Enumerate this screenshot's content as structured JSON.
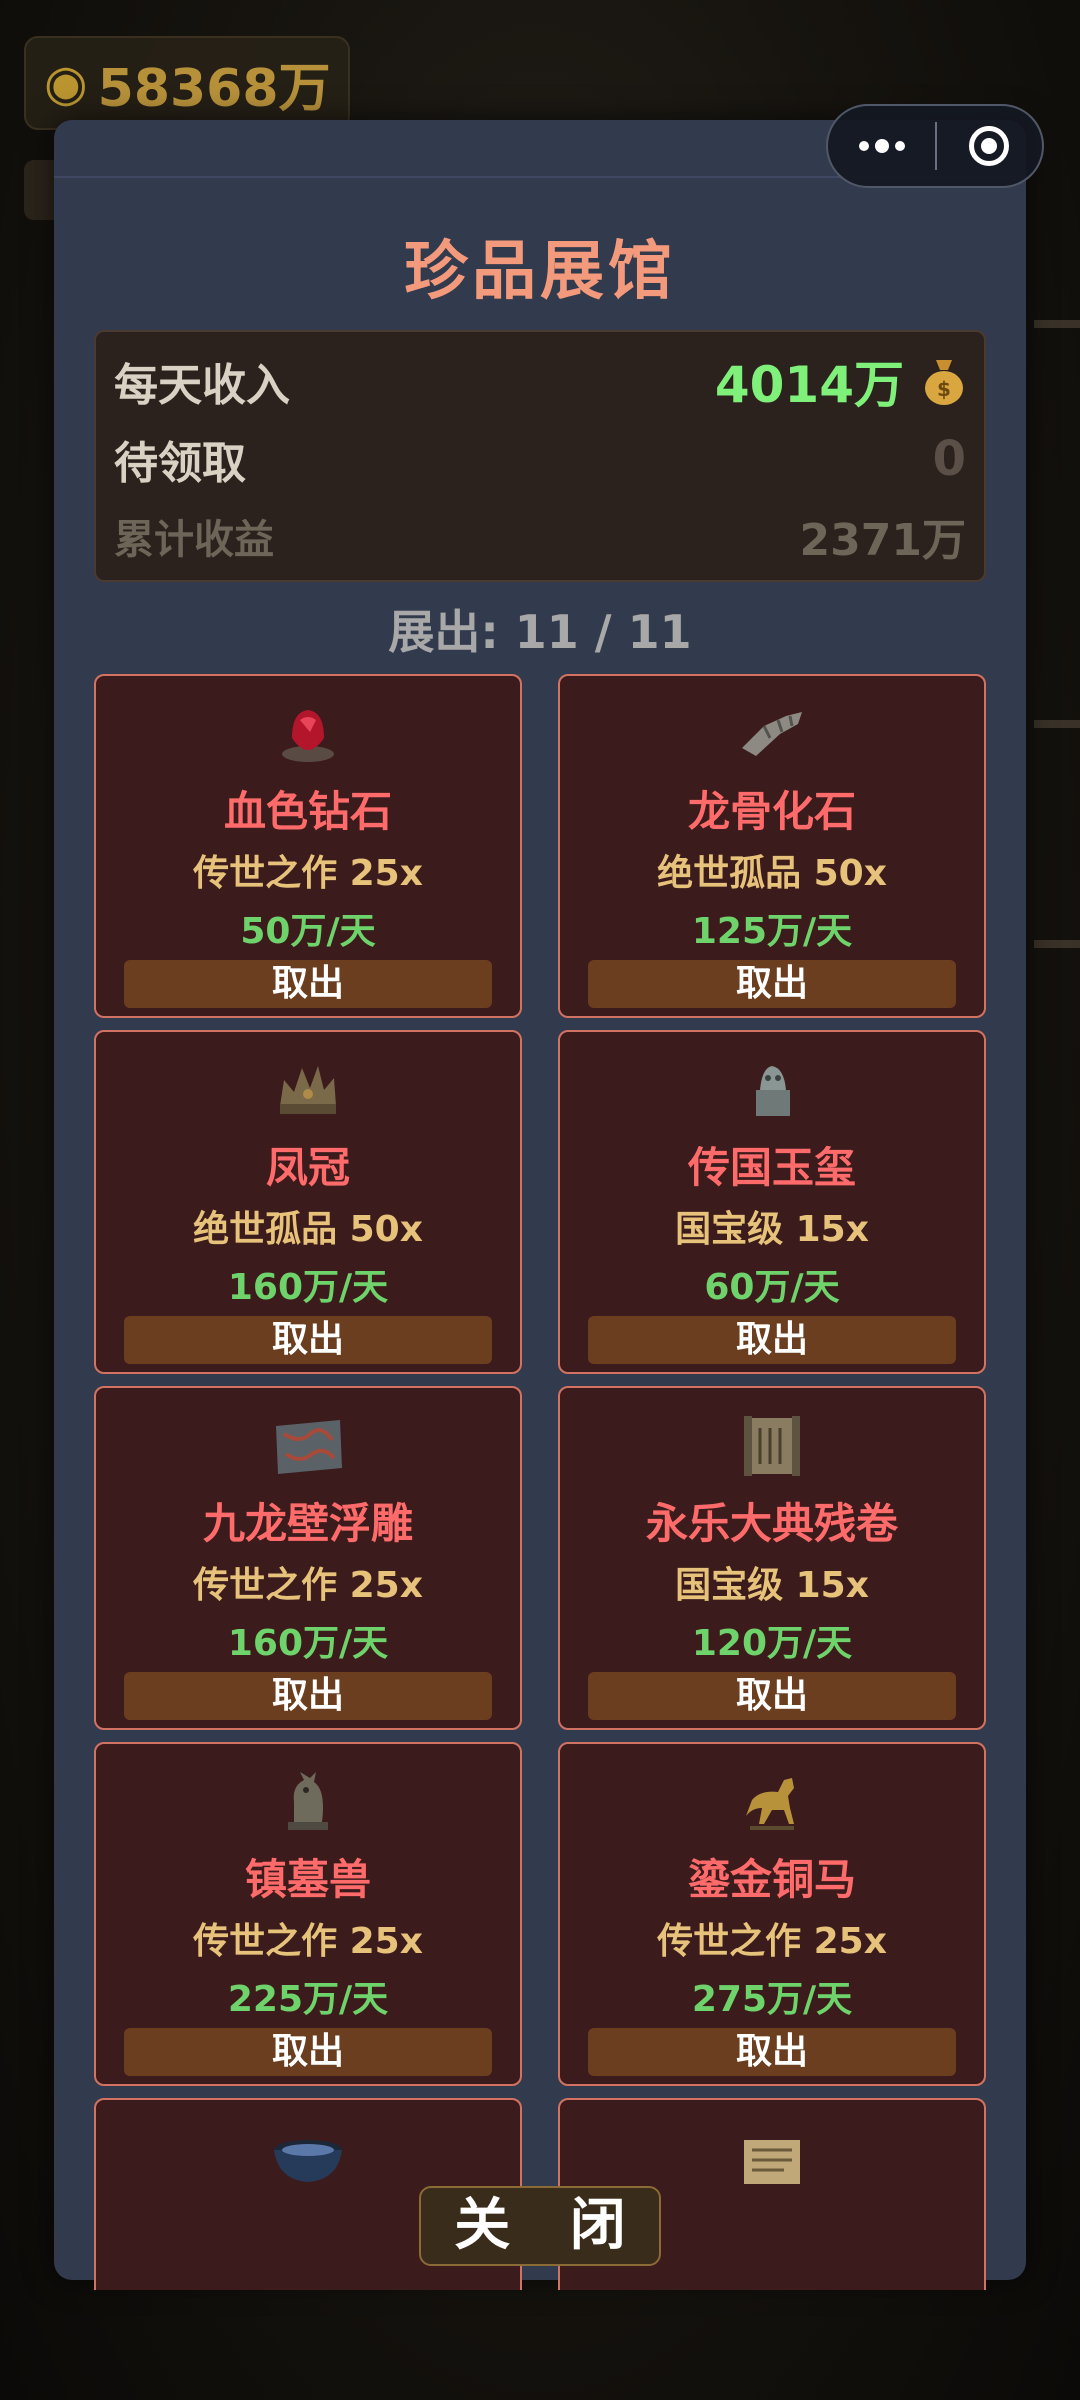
{
  "hud": {
    "money_icon": "money-bag-icon",
    "money": "58368万"
  },
  "title": "珍品展馆",
  "stats": {
    "daily_income_label": "每天收入",
    "daily_income_value": "4014万",
    "pending_label": "待领取",
    "pending_value": "0",
    "total_label": "累计收益",
    "total_value": "2371万"
  },
  "display_count": "展出: 11 / 11",
  "items": [
    {
      "name": "血色钻石",
      "tier": "传世之作 25x",
      "rate": "50万/天",
      "button": "取出",
      "icon": "red-diamond-icon"
    },
    {
      "name": "龙骨化石",
      "tier": "绝世孤品 50x",
      "rate": "125万/天",
      "button": "取出",
      "icon": "dragon-bone-fossil-icon"
    },
    {
      "name": "凤冠",
      "tier": "绝世孤品 50x",
      "rate": "160万/天",
      "button": "取出",
      "icon": "phoenix-crown-icon"
    },
    {
      "name": "传国玉玺",
      "tier": "国宝级 15x",
      "rate": "60万/天",
      "button": "取出",
      "icon": "imperial-jade-seal-icon"
    },
    {
      "name": "九龙壁浮雕",
      "tier": "传世之作 25x",
      "rate": "160万/天",
      "button": "取出",
      "icon": "nine-dragon-relief-icon"
    },
    {
      "name": "永乐大典残卷",
      "tier": "国宝级 15x",
      "rate": "120万/天",
      "button": "取出",
      "icon": "ancient-scroll-icon"
    },
    {
      "name": "镇墓兽",
      "tier": "传世之作 25x",
      "rate": "225万/天",
      "button": "取出",
      "icon": "tomb-beast-icon"
    },
    {
      "name": "鎏金铜马",
      "tier": "传世之作 25x",
      "rate": "275万/天",
      "button": "取出",
      "icon": "gilded-bronze-horse-icon"
    },
    {
      "name": "",
      "tier": "",
      "rate": "",
      "button": "",
      "icon": "porcelain-bowl-icon"
    },
    {
      "name": "",
      "tier": "",
      "rate": "",
      "button": "",
      "icon": "document-icon"
    }
  ],
  "close_button": "关 闭",
  "capsule": {
    "more_icon": "more-dots-icon",
    "close_icon": "target-close-icon"
  }
}
